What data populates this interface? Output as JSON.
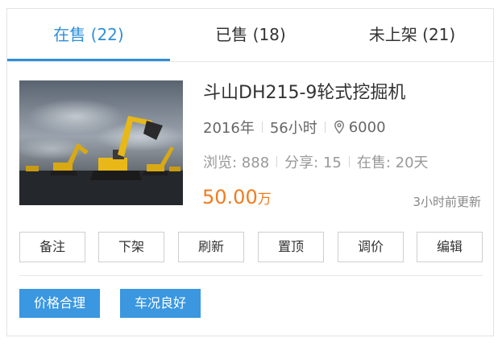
{
  "tabs": [
    {
      "label": "在售 (22)",
      "active": true
    },
    {
      "label": "已售 (18)",
      "active": false
    },
    {
      "label": "未上架 (21)",
      "active": false
    }
  ],
  "listing": {
    "title": "斗山DH215-9轮式挖掘机",
    "year": "2016年",
    "hours": "56小时",
    "location_icon": "location-pin-icon",
    "location": "6000",
    "views": "浏览: 888",
    "shares": "分享: 15",
    "on_sale": "在售: 20天",
    "price_value": "50.00",
    "price_unit": "万",
    "updated": "3小时前更新"
  },
  "actions": [
    "备注",
    "下架",
    "刷新",
    "置顶",
    "调价",
    "编辑"
  ],
  "tags": [
    "价格合理",
    "车况良好"
  ],
  "colors": {
    "accent": "#2e8fd8",
    "price": "#f37b1d",
    "tag_bg": "#3a97e0"
  }
}
